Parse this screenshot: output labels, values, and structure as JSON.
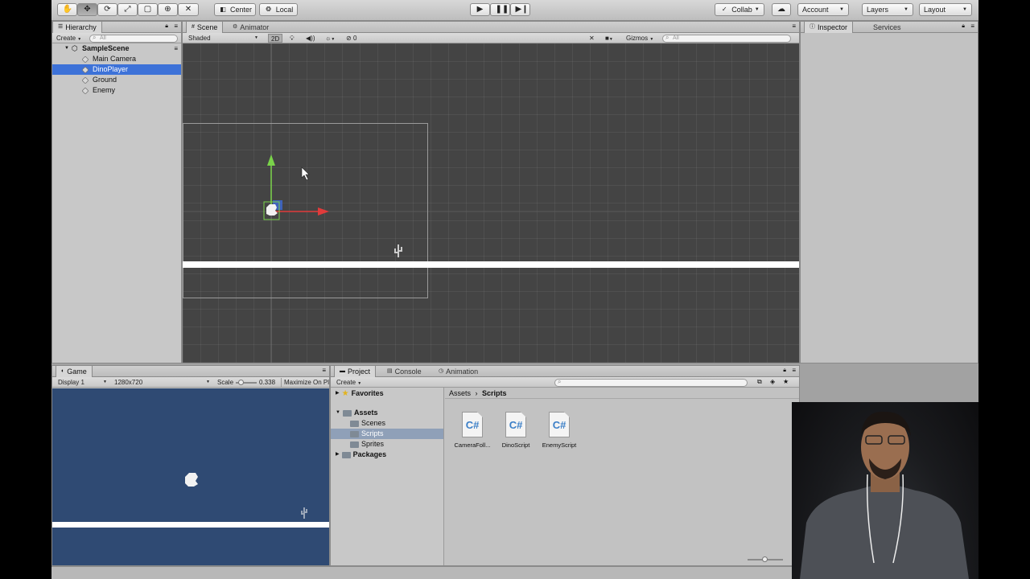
{
  "toolbar": {
    "tools": [
      "hand-tool",
      "move-tool",
      "rotate-tool",
      "scale-tool",
      "rect-tool",
      "transform-tool",
      "custom-tool"
    ],
    "pivot_label": "Center",
    "space_label": "Local",
    "collab_label": "Collab",
    "account_label": "Account",
    "layers_label": "Layers",
    "layout_label": "Layout"
  },
  "hierarchy": {
    "tab_label": "Hierarchy",
    "create_label": "Create",
    "search_placeholder": "All",
    "scene_name": "SampleScene",
    "items": [
      {
        "label": "Main Camera"
      },
      {
        "label": "DinoPlayer"
      },
      {
        "label": "Ground"
      },
      {
        "label": "Enemy"
      }
    ]
  },
  "scene": {
    "tab_label": "Scene",
    "animator_tab_label": "Animator",
    "shading_mode": "Shaded",
    "mode_2d": "2D",
    "fx_count": "0",
    "gizmos_label": "Gizmos",
    "search_placeholder": "All"
  },
  "inspector": {
    "tab_label": "Inspector",
    "services_tab_label": "Services"
  },
  "game": {
    "tab_label": "Game",
    "display_label": "Display 1",
    "resolution_label": "1280x720",
    "scale_label": "Scale",
    "scale_value": "0.338",
    "maximize_label": "Maximize On Pl",
    "scale_fraction": 0.1
  },
  "project": {
    "tab_label": "Project",
    "console_tab_label": "Console",
    "animation_tab_label": "Animation",
    "create_label": "Create",
    "tree": {
      "favorites": "Favorites",
      "assets": "Assets",
      "scenes": "Scenes",
      "scripts": "Scripts",
      "sprites": "Sprites",
      "packages": "Packages"
    },
    "breadcrumb": {
      "root": "Assets",
      "current": "Scripts"
    },
    "files": [
      {
        "icon_text": "C#",
        "name": "CameraFoll..."
      },
      {
        "icon_text": "C#",
        "name": "DinoScript"
      },
      {
        "icon_text": "C#",
        "name": "EnemyScript"
      }
    ]
  },
  "colors": {
    "selection": "#3d72d8",
    "scene_bg": "#444444",
    "game_bg": "#2f4a73",
    "panel_bg": "#c2c2c2"
  }
}
